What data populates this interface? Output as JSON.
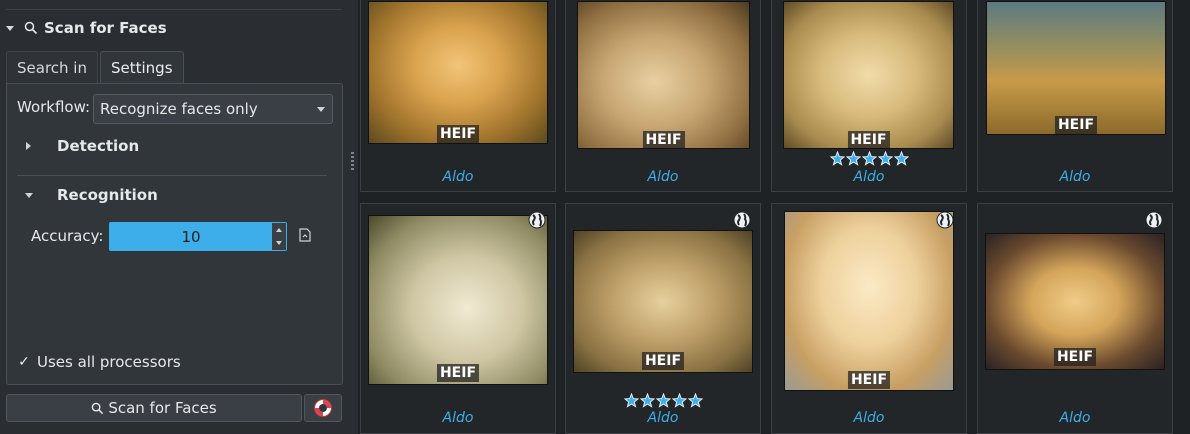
{
  "panel": {
    "section_title": "Scan for Faces",
    "tabs": [
      {
        "label": "Search in",
        "active": false
      },
      {
        "label": "Settings",
        "active": true
      }
    ],
    "workflow": {
      "label": "Workflow:",
      "value": "Recognize faces only"
    },
    "detection": {
      "label": "Detection",
      "expanded": false
    },
    "recognition": {
      "label": "Recognition",
      "expanded": true
    },
    "accuracy": {
      "label": "Accuracy:",
      "value": "10"
    },
    "uses_all_processors": {
      "label": "Uses all processors",
      "checked": true
    },
    "scan_button": {
      "label": "Scan for Faces"
    }
  },
  "grid": {
    "items": [
      {
        "badge": "HEIF",
        "caption": "Aldo",
        "stars": 0,
        "globe": false
      },
      {
        "badge": "HEIF",
        "caption": "Aldo",
        "stars": 0,
        "globe": false
      },
      {
        "badge": "HEIF",
        "caption": "Aldo",
        "stars": 5,
        "globe": false
      },
      {
        "badge": "HEIF",
        "caption": "Aldo",
        "stars": 0,
        "globe": false
      },
      {
        "badge": "HEIF",
        "caption": "Aldo",
        "stars": 0,
        "globe": true
      },
      {
        "badge": "HEIF",
        "caption": "Aldo",
        "stars": 5,
        "globe": true
      },
      {
        "badge": "HEIF",
        "caption": "Aldo",
        "stars": 0,
        "globe": true
      },
      {
        "badge": "HEIF",
        "caption": "Aldo",
        "stars": 0,
        "globe": true
      }
    ]
  },
  "colors": {
    "accent": "#3daee9",
    "background": "#2a2e32",
    "grid_background": "#1f2225"
  }
}
